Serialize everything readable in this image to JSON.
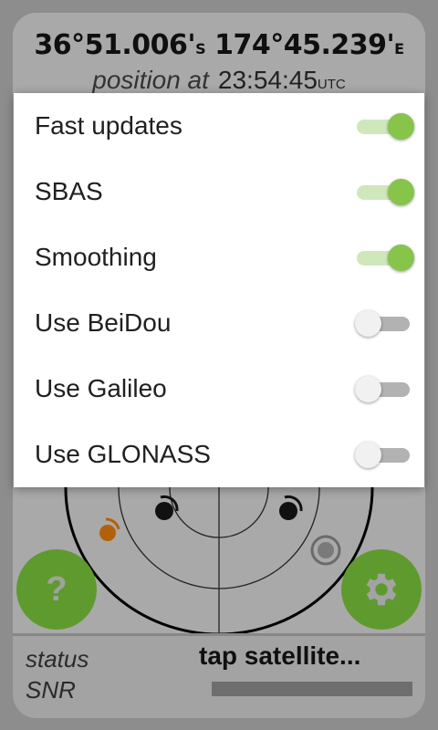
{
  "header": {
    "latitude": "36°51.006'",
    "lat_hemi": "S",
    "longitude": "174°45.239'",
    "lon_hemi": "E",
    "position_label": "position at",
    "time": "23:54:45",
    "time_zone": "UTC"
  },
  "settings": {
    "items": [
      {
        "label": "Fast updates",
        "enabled": true
      },
      {
        "label": "SBAS",
        "enabled": true
      },
      {
        "label": "Smoothing",
        "enabled": true
      },
      {
        "label": "Use BeiDou",
        "enabled": false
      },
      {
        "label": "Use Galileo",
        "enabled": false
      },
      {
        "label": "Use GLONASS",
        "enabled": false
      }
    ]
  },
  "buttons": {
    "help_label": "?",
    "help_icon": "help-icon",
    "settings_icon": "gear-icon"
  },
  "status": {
    "status_label": "status",
    "status_value": "tap satellite...",
    "snr_label": "SNR"
  },
  "colors": {
    "accent": "#86c44a",
    "fab": "#5f9a2f",
    "dialog_bg": "#ffffff"
  }
}
